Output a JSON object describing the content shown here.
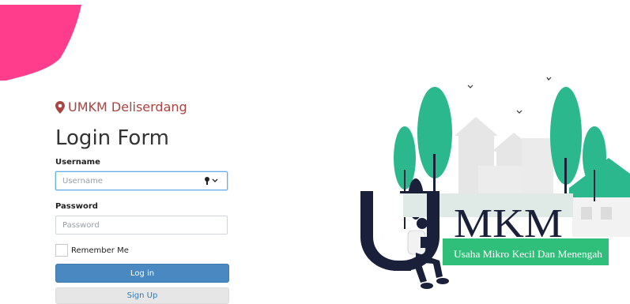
{
  "brand": {
    "name": "UMKM Deliserdang",
    "icon": "map-marker-icon",
    "color": "#a94442"
  },
  "form": {
    "title": "Login Form",
    "username": {
      "label": "Username",
      "placeholder": "Username",
      "value": ""
    },
    "password": {
      "label": "Password",
      "placeholder": "Password",
      "value": ""
    },
    "remember": {
      "label": "Remember Me",
      "checked": false
    },
    "login_button": "Log in",
    "signup_button": "Sign Up"
  },
  "illustration": {
    "logo_text": "MKM",
    "logo_initial": "U",
    "tagline": "Usaha Mikro Kecil Dan Menengah"
  },
  "colors": {
    "accent_pink": "#ff3d8c",
    "primary_button": "#4a88c2",
    "tree_green": "#2bb88c",
    "banner_green": "#2fbf7a",
    "dark_navy": "#1a1f3a"
  }
}
